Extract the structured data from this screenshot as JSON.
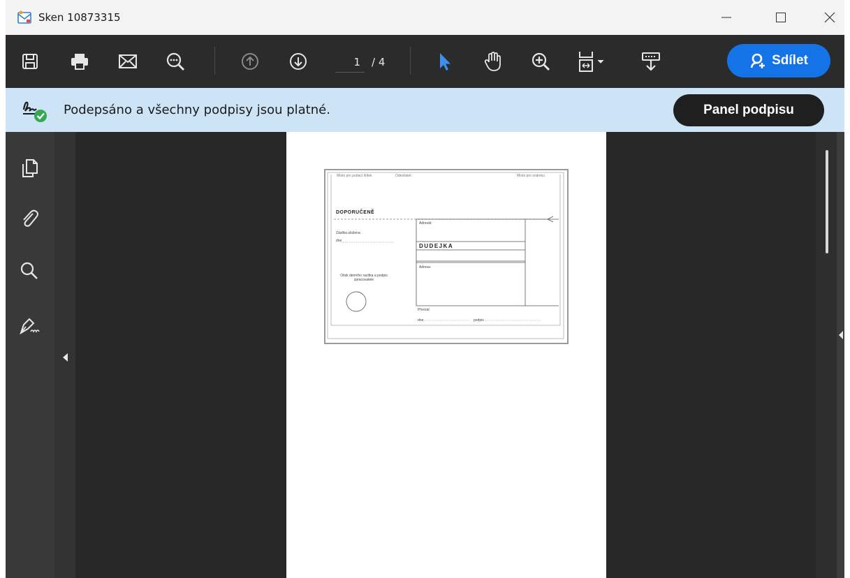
{
  "window": {
    "title": "Sken 10873315"
  },
  "toolbar": {
    "current_page": "1",
    "total_pages": "/ 4",
    "share_label": "Sdílet",
    "icons": [
      "save-icon",
      "print-icon",
      "email-icon",
      "zoom-out-icon",
      "previous-page-icon",
      "next-page-icon",
      "select-pointer-icon",
      "hand-tool-icon",
      "zoom-in-icon",
      "fit-page-icon",
      "scroll-mode-icon",
      "share-user-icon"
    ]
  },
  "signature_bar": {
    "message": "Podepsáno a všechny podpisy jsou platné.",
    "panel_button": "Panel podpisu"
  },
  "left_rail": {
    "icons": [
      "page-thumbnails-icon",
      "attachments-icon",
      "search-icon",
      "signatures-icon"
    ]
  },
  "document": {
    "scan": {
      "header_left": "Místo pro podací štítek",
      "header_mid": "Odesílatel:",
      "header_right": "Místo pro známku",
      "registered": "DOPORUČENĚ",
      "recipient_label": "Adresát:",
      "name": "DUDEJKA",
      "address_label": "Adresa:",
      "parcel_label": "Zásilka uložena",
      "day_label": "dne",
      "stamp_label": "Otisk denního razítka a podpis zpracovatele",
      "received_label": "Převzal",
      "date_label": "dne",
      "signature_label": "podpis"
    }
  },
  "colors": {
    "toolbar_bg": "#2b2b2b",
    "banner_bg": "#cde4f7",
    "accent": "#1473e6",
    "doc_bg": "#282828",
    "valid_green": "#34a853"
  }
}
